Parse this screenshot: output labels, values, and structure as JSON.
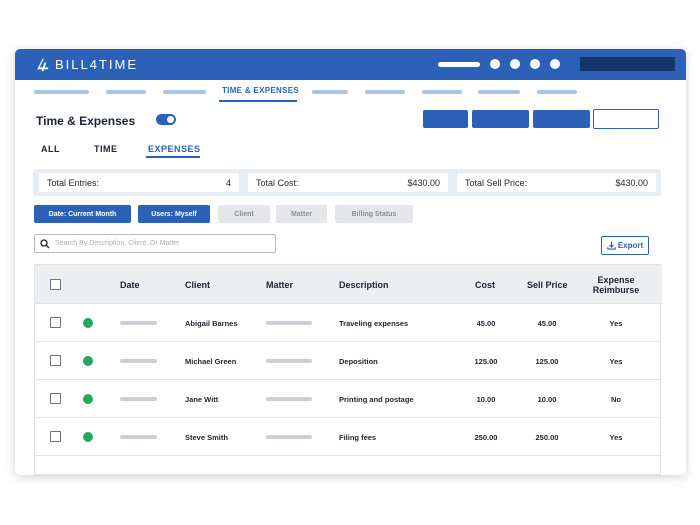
{
  "brand": {
    "name": "BILL4TIME"
  },
  "nav": {
    "active_label": "TIME & EXPENSES"
  },
  "page": {
    "title": "Time & Expenses"
  },
  "tabs": [
    {
      "label": "ALL"
    },
    {
      "label": "TIME"
    },
    {
      "label": "EXPENSES",
      "active": true
    }
  ],
  "totals": {
    "entries_label": "Total Entries:",
    "entries_value": "4",
    "cost_label": "Total Cost:",
    "cost_value": "$430.00",
    "sell_label": "Total Sell Price:",
    "sell_value": "$430.00"
  },
  "filters": [
    {
      "label": "Date: Current Month",
      "active": true
    },
    {
      "label": "Users: Myself",
      "active": true
    },
    {
      "label": "Client",
      "active": false
    },
    {
      "label": "Matter",
      "active": false
    },
    {
      "label": "Billing Status",
      "active": false
    }
  ],
  "search": {
    "placeholder": "Search By Description, Client, Or Matter"
  },
  "export": {
    "label": "Export",
    "icon": "download-icon"
  },
  "table": {
    "headers": {
      "date": "Date",
      "client": "Client",
      "matter": "Matter",
      "description": "Description",
      "cost": "Cost",
      "sell": "Sell Price",
      "reimburse_1": "Expense",
      "reimburse_2": "Reimburse"
    },
    "rows": [
      {
        "client": "Abigail Barnes",
        "description": "Traveling expenses",
        "cost": "45.00",
        "sell": "45.00",
        "reimburse": "Yes"
      },
      {
        "client": "Michael Green",
        "description": "Deposition",
        "cost": "125.00",
        "sell": "125.00",
        "reimburse": "Yes"
      },
      {
        "client": "Jane Witt",
        "description": "Printing and postage",
        "cost": "10.00",
        "sell": "10.00",
        "reimburse": "No"
      },
      {
        "client": "Steve Smith",
        "description": "Filing fees",
        "cost": "250.00",
        "sell": "250.00",
        "reimburse": "Yes"
      }
    ]
  },
  "colors": {
    "primary": "#2b62b8",
    "dark": "#17356d",
    "status_green": "#22a861"
  }
}
